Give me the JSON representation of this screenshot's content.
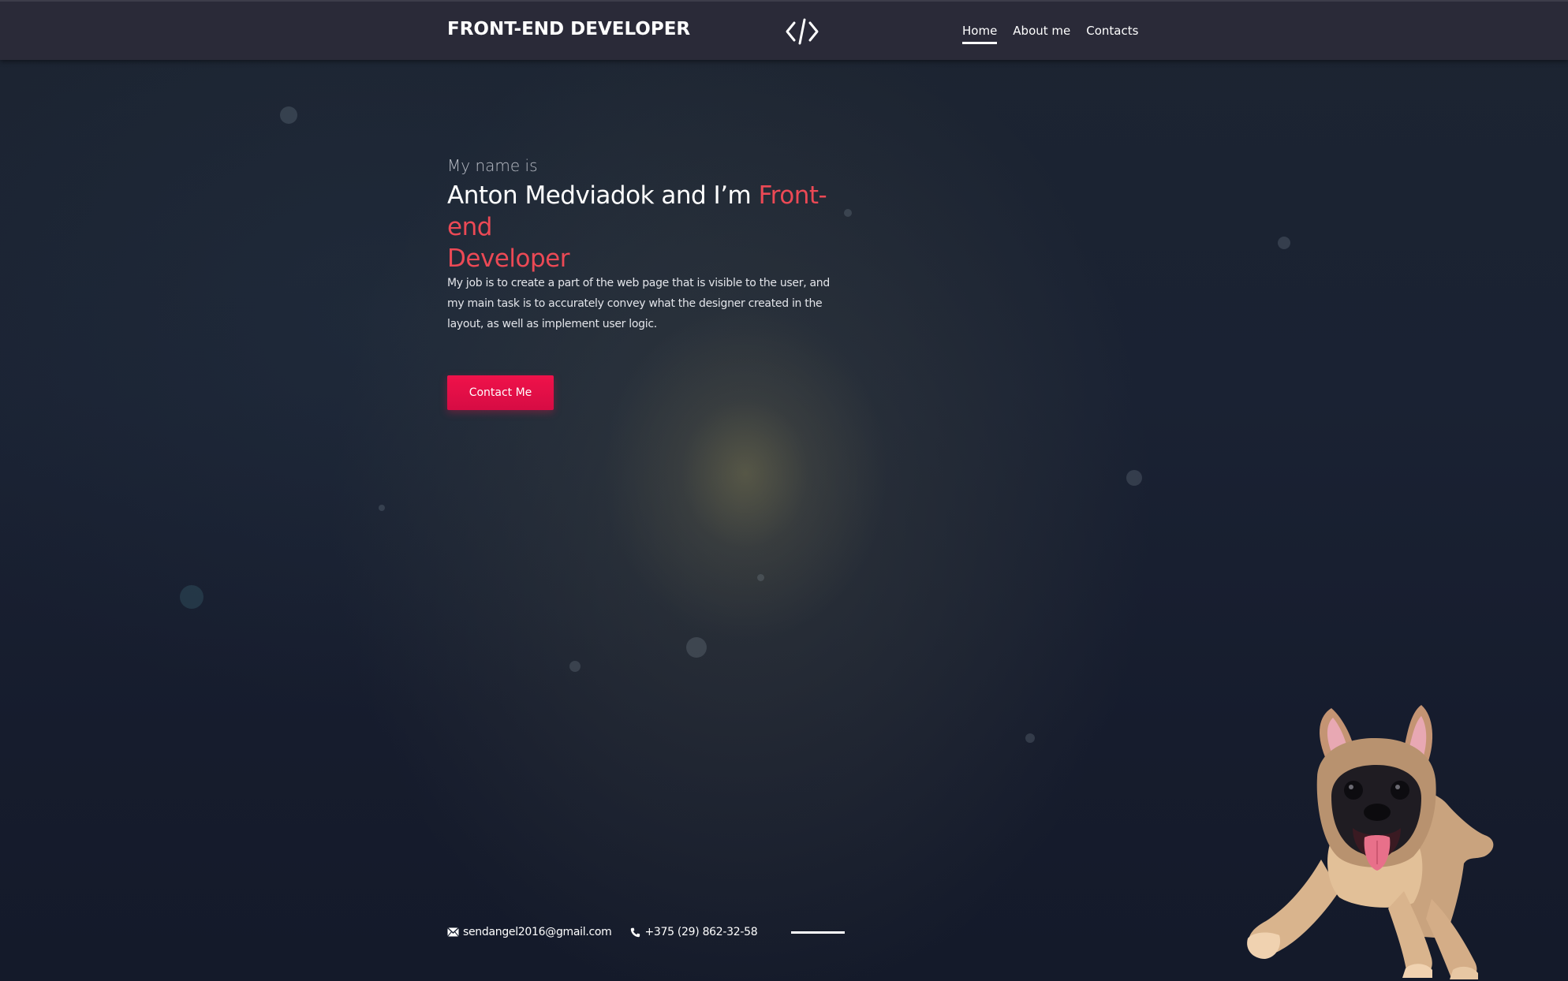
{
  "header": {
    "brand": "FRONT-END DEVELOPER",
    "logo_icon": "code-brackets-icon",
    "nav": [
      {
        "label": "Home",
        "active": true
      },
      {
        "label": "About me",
        "active": false
      },
      {
        "label": "Contacts",
        "active": false
      }
    ]
  },
  "hero": {
    "intro": "My name is",
    "headline_prefix": "Anton Medviadok and I’m ",
    "headline_accent_1": "Front-end",
    "headline_accent_2": "Developer",
    "description": "My job is to create a part of the web page that is visible to the user, and my main task is to accurately convey what the designer created in the layout, as well as implement user logic.",
    "cta_label": "Contact Me"
  },
  "contacts": {
    "email": "sendangel2016@gmail.com",
    "email_icon": "envelope-icon",
    "phone": "+375 (29) 862-32-58",
    "phone_icon": "phone-icon"
  },
  "colors": {
    "accent": "#ec4955",
    "button": "#e81048",
    "header_bg": "#2a2a38",
    "page_bg": "#1a2233"
  }
}
